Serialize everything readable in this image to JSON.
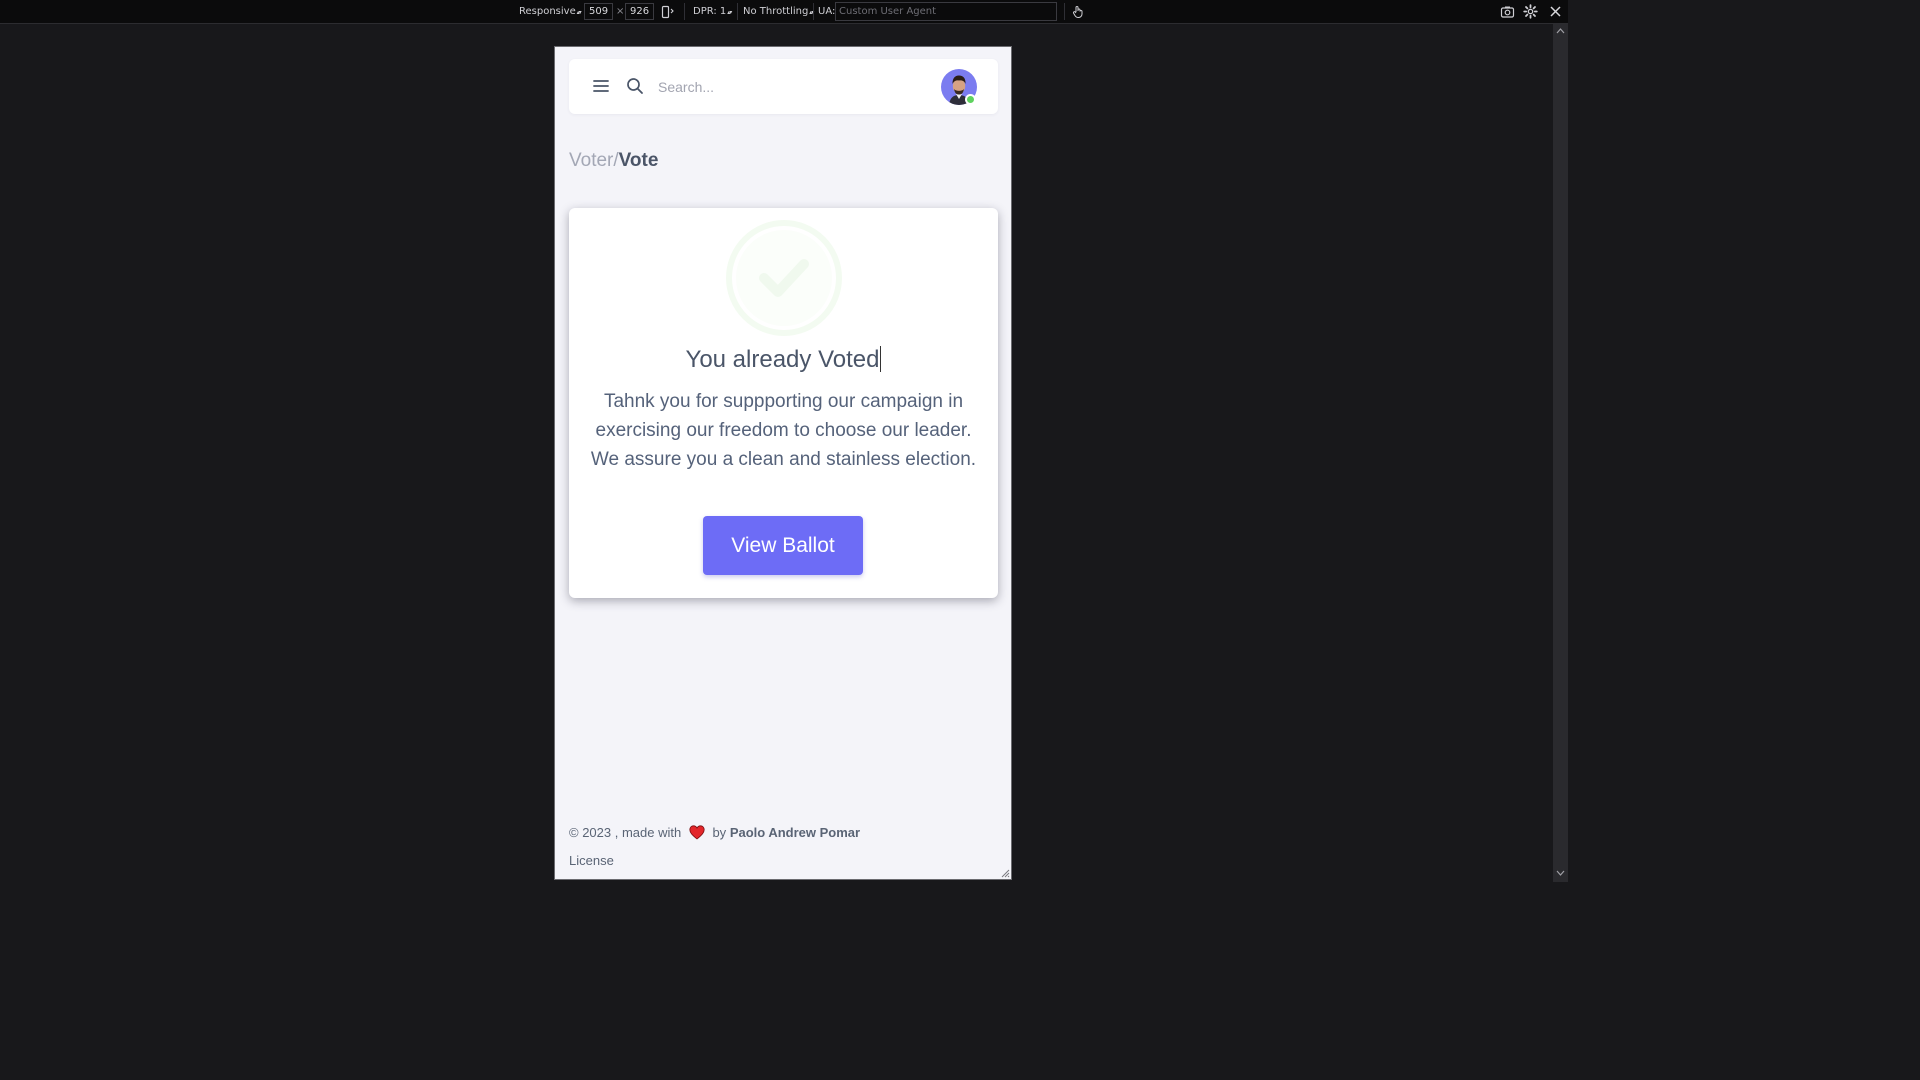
{
  "devtools": {
    "device_mode": "Responsive",
    "width": "509",
    "times": "×",
    "height": "926",
    "dpr": "DPR: 1",
    "throttling": "No Throttling",
    "ua_label": "UA:",
    "ua_placeholder": "Custom User Agent"
  },
  "navbar": {
    "search_placeholder": "Search...",
    "online_color": "#5fd25f"
  },
  "breadcrumb": {
    "parent": "Voter/",
    "current": "Vote"
  },
  "card": {
    "icon": "check-circle-icon",
    "title": "You already Voted",
    "message": "Tahnk you for suppporting our campaign in exercising our freedom to choose our leader. We assure you a clean and stainless election.",
    "button_label": "View Ballot",
    "button_color": "#6d6cf6"
  },
  "footer": {
    "prefix": "© 2023 , made with",
    "by": "by",
    "author": "Paolo Andrew Pomar",
    "license": "License",
    "heart_color": "#e3262b"
  }
}
